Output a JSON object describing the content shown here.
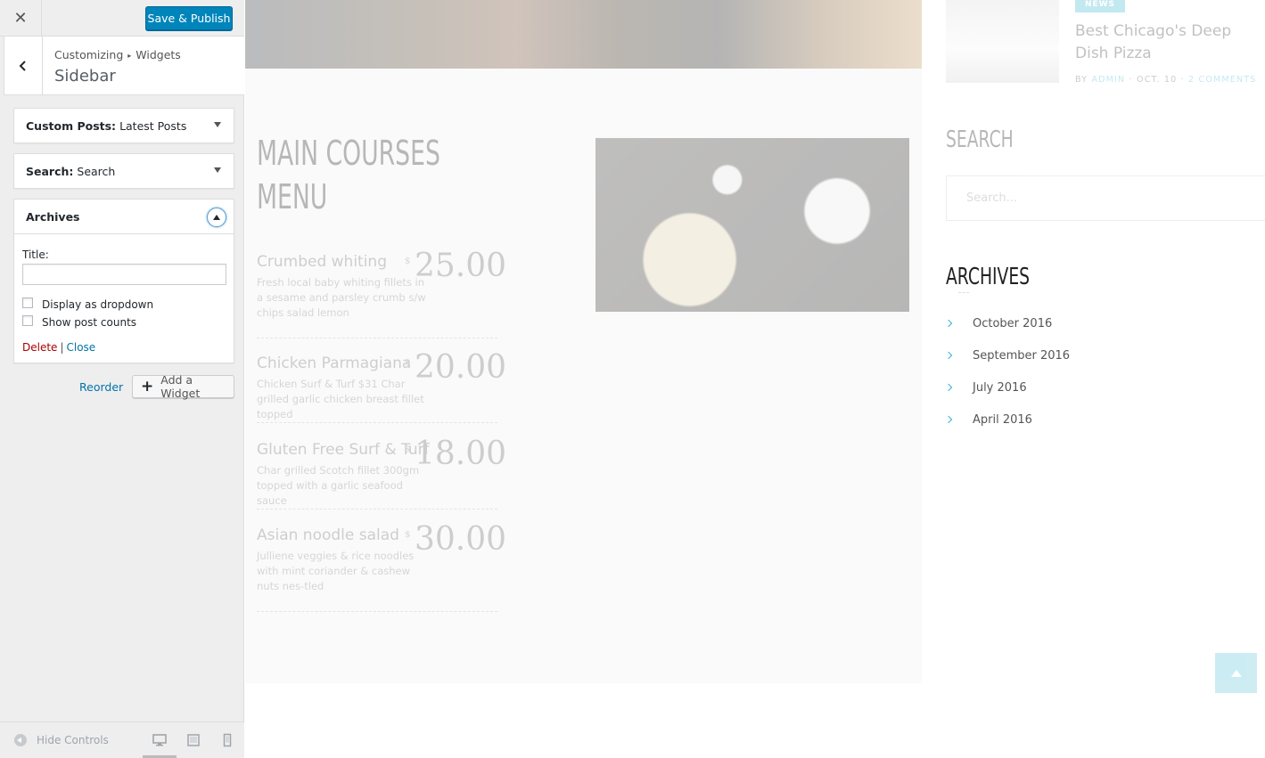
{
  "customizer": {
    "close_icon": "close-icon",
    "publish_label": "Save & Publish",
    "breadcrumb": {
      "root": "Customizing",
      "current": "Widgets"
    },
    "section_title": "Sidebar",
    "widgets": [
      {
        "type": "Custom Posts:",
        "value": "Latest Posts",
        "expanded": false
      },
      {
        "type": "Search:",
        "value": "Search",
        "expanded": false
      },
      {
        "type": "Archives",
        "value": "",
        "expanded": true,
        "form": {
          "title_label": "Title:",
          "title_value": "",
          "checkbox_dropdown": "Display as dropdown",
          "checkbox_counts": "Show post counts",
          "delete_label": "Delete",
          "separator": "|",
          "close_label": "Close"
        }
      }
    ],
    "reorder_label": "Reorder",
    "add_widget_label": "Add a Widget",
    "footer": {
      "hide_controls_label": "Hide Controls",
      "devices": [
        "desktop",
        "tablet",
        "mobile"
      ],
      "active_device": "desktop"
    }
  },
  "preview": {
    "menu_title": "MAIN COURSES MENU",
    "currency": "$",
    "dishes": [
      {
        "name": "Crumbed whiting",
        "desc": "Fresh local baby whiting fillets in a sesame and parsley crumb s/w chips salad lemon",
        "price": "25.00"
      },
      {
        "name": "Chicken Parmagiana",
        "desc": "Chicken Surf & Turf $31 Char grilled garlic chicken breast fillet topped",
        "price": "20.00"
      },
      {
        "name": "Gluten Free Surf & Turf",
        "desc": "Char grilled Scotch fillet 300gm topped with a garlic seafood sauce",
        "price": "18.00"
      },
      {
        "name": "Asian noodle salad",
        "desc": "Julliene veggies & rice noodles with mint coriander & cashew nuts nes-tled",
        "price": "30.00"
      }
    ],
    "recent_post": {
      "badge": "NEWS",
      "title": "Best Chicago's Deep Dish Pizza",
      "meta_by": "BY",
      "meta_author": "ADMIN",
      "meta_date": "· OCT. 10 ·",
      "meta_comments": "2 COMMENTS"
    },
    "search_heading": "SEARCH",
    "search_placeholder": "Search...",
    "archives_heading": "ARCHIVES",
    "archives": [
      "October 2016",
      "September 2016",
      "July 2016",
      "April 2016"
    ],
    "accent_color": "#38b7d1"
  }
}
